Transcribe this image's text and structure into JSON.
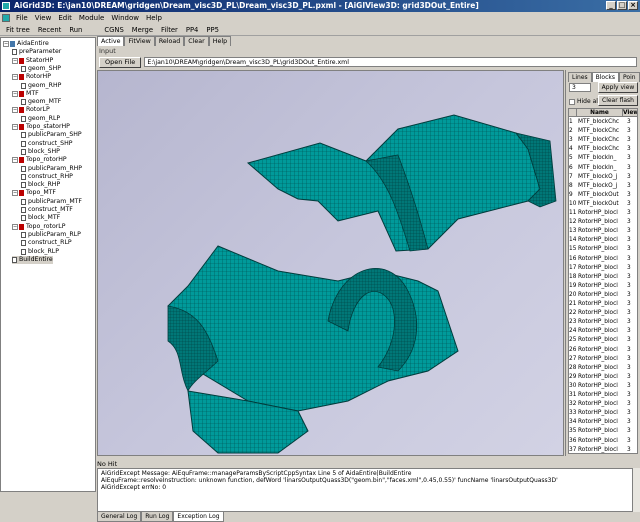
{
  "window": {
    "title": "AiGrid3D: E:\\jan10\\DREAM\\gridgen\\Dream_visc3D_PL\\Dream_visc3D_PL.pxml - [AiGIView3D: grid3DOut_Entire]"
  },
  "menu": [
    "File",
    "View",
    "Edit",
    "Module",
    "Window",
    "Help"
  ],
  "tree_toolbar": [
    "Fit tree",
    "Recent",
    "Run"
  ],
  "main_toolbar": [
    "CGNS",
    "Merge",
    "Filter",
    "PP4",
    "PP5"
  ],
  "tree": [
    {
      "label": "AidaEntire",
      "level": 0,
      "icon": "folder-icon"
    },
    {
      "label": "preParameter",
      "level": 1,
      "icon": "page-icon"
    },
    {
      "label": "StatorHP",
      "level": 1,
      "icon": "red-module-icon"
    },
    {
      "label": "geom_SHP",
      "level": 2,
      "icon": "page-icon"
    },
    {
      "label": "RotorHP",
      "level": 1,
      "icon": "red-module-icon"
    },
    {
      "label": "geom_RHP",
      "level": 2,
      "icon": "page-icon"
    },
    {
      "label": "MTF",
      "level": 1,
      "icon": "red-module-icon"
    },
    {
      "label": "geom_MTF",
      "level": 2,
      "icon": "page-icon"
    },
    {
      "label": "RotorLP",
      "level": 1,
      "icon": "red-module-icon"
    },
    {
      "label": "geom_RLP",
      "level": 2,
      "icon": "page-icon"
    },
    {
      "label": "Topo_statorHP",
      "level": 1,
      "icon": "red-module-icon"
    },
    {
      "label": "publicParam_SHP",
      "level": 2,
      "icon": "page-icon"
    },
    {
      "label": "construct_SHP",
      "level": 2,
      "icon": "page-icon"
    },
    {
      "label": "block_SHP",
      "level": 2,
      "icon": "page-icon"
    },
    {
      "label": "Topo_rotorHP",
      "level": 1,
      "icon": "red-module-icon"
    },
    {
      "label": "publicParam_RHP",
      "level": 2,
      "icon": "page-icon"
    },
    {
      "label": "construct_RHP",
      "level": 2,
      "icon": "page-icon"
    },
    {
      "label": "block_RHP",
      "level": 2,
      "icon": "page-icon"
    },
    {
      "label": "Topo_MTF",
      "level": 1,
      "icon": "red-module-icon"
    },
    {
      "label": "publicParam_MTF",
      "level": 2,
      "icon": "page-icon"
    },
    {
      "label": "construct_MTF",
      "level": 2,
      "icon": "page-icon"
    },
    {
      "label": "block_MTF",
      "level": 2,
      "icon": "page-icon"
    },
    {
      "label": "Topo_rotorLP",
      "level": 1,
      "icon": "red-module-icon"
    },
    {
      "label": "publicParam_RLP",
      "level": 2,
      "icon": "page-icon"
    },
    {
      "label": "construct_RLP",
      "level": 2,
      "icon": "page-icon"
    },
    {
      "label": "block_RLP",
      "level": 2,
      "icon": "page-icon"
    },
    {
      "label": "BuildEntire",
      "level": 1,
      "icon": "page-icon"
    }
  ],
  "view_tabs": [
    "Active",
    "FitView",
    "Reload",
    "Clear",
    "Help"
  ],
  "input_label": "Input",
  "open_file": {
    "label": "Open File",
    "path": "E:\\jan10\\DREAM\\gridgen\\Dream_visc3D_PL\\grid3DOut_Entire.xml"
  },
  "side_tabs": [
    "Lines",
    "Blocks",
    "Poin"
  ],
  "side": {
    "spin_value": "3",
    "apply_view": "Apply view",
    "hide_all": "Hide all",
    "clear_flash": "Clear flash",
    "col_name": "Name",
    "col_view": "View"
  },
  "blocks": [
    {
      "id": "1",
      "name": "MTF_blockChc",
      "view": "3"
    },
    {
      "id": "2",
      "name": "MTF_blockChc",
      "view": "3"
    },
    {
      "id": "3",
      "name": "MTF_blockChc",
      "view": "3"
    },
    {
      "id": "4",
      "name": "MTF_blockChc",
      "view": "3"
    },
    {
      "id": "5",
      "name": "MTF_blockIn_",
      "view": "3"
    },
    {
      "id": "6",
      "name": "MTF_blockIn_",
      "view": "3"
    },
    {
      "id": "7",
      "name": "MTF_blockO_j",
      "view": "3"
    },
    {
      "id": "8",
      "name": "MTF_blockO_j",
      "view": "3"
    },
    {
      "id": "9",
      "name": "MTF_blockOut",
      "view": "3"
    },
    {
      "id": "10",
      "name": "MTF_blockOut",
      "view": "3"
    },
    {
      "id": "11",
      "name": "RotorHP_blocl",
      "view": "3"
    },
    {
      "id": "12",
      "name": "RotorHP_blocl",
      "view": "3"
    },
    {
      "id": "13",
      "name": "RotorHP_blocl",
      "view": "3"
    },
    {
      "id": "14",
      "name": "RotorHP_blocl",
      "view": "3"
    },
    {
      "id": "15",
      "name": "RotorHP_blocl",
      "view": "3"
    },
    {
      "id": "16",
      "name": "RotorHP_blocl",
      "view": "3"
    },
    {
      "id": "17",
      "name": "RotorHP_blocl",
      "view": "3"
    },
    {
      "id": "18",
      "name": "RotorHP_blocl",
      "view": "3"
    },
    {
      "id": "19",
      "name": "RotorHP_blocl",
      "view": "3"
    },
    {
      "id": "20",
      "name": "RotorHP_blocl",
      "view": "3"
    },
    {
      "id": "21",
      "name": "RotorHP_blocl",
      "view": "3"
    },
    {
      "id": "22",
      "name": "RotorHP_blocl",
      "view": "3"
    },
    {
      "id": "23",
      "name": "RotorHP_blocl",
      "view": "3"
    },
    {
      "id": "24",
      "name": "RotorHP_blocl",
      "view": "3"
    },
    {
      "id": "25",
      "name": "RotorHP_blocl",
      "view": "3"
    },
    {
      "id": "26",
      "name": "RotorHP_blocl",
      "view": "3"
    },
    {
      "id": "27",
      "name": "RotorHP_blocl",
      "view": "3"
    },
    {
      "id": "28",
      "name": "RotorHP_blocl",
      "view": "3"
    },
    {
      "id": "29",
      "name": "RotorHP_blocl",
      "view": "3"
    },
    {
      "id": "30",
      "name": "RotorHP_blocl",
      "view": "3"
    },
    {
      "id": "31",
      "name": "RotorHP_blocl",
      "view": "3"
    },
    {
      "id": "32",
      "name": "RotorHP_blocl",
      "view": "3"
    },
    {
      "id": "33",
      "name": "RotorHP_blocl",
      "view": "3"
    },
    {
      "id": "34",
      "name": "RotorHP_blocl",
      "view": "3"
    },
    {
      "id": "35",
      "name": "RotorHP_blocl",
      "view": "3"
    },
    {
      "id": "36",
      "name": "RotorHP_blocl",
      "view": "3"
    },
    {
      "id": "37",
      "name": "RotorHP_blocl",
      "view": "3"
    }
  ],
  "status": "No Hit",
  "log": [
    "AiGridExcept Message: AiEquFrame::manageParamsByScriptCppSyntax Line 5 of AidaEntire|BuildEntire",
    "          AiEquFrame::resolveInstruction: unknown function, defWord 'linarsOutputQuass3D(\"geom.bin\",\"faces.xml\",0.45,0.55)' funcName 'linarsOutputQuass3D'",
    "AiGridExcept    errNo: 0"
  ],
  "log_tabs": [
    "General Log",
    "Run Log",
    "Exception Log"
  ],
  "colors": {
    "mesh": "#008b8b",
    "mesh_dark": "#006a6a",
    "background": "#c4c4da"
  }
}
